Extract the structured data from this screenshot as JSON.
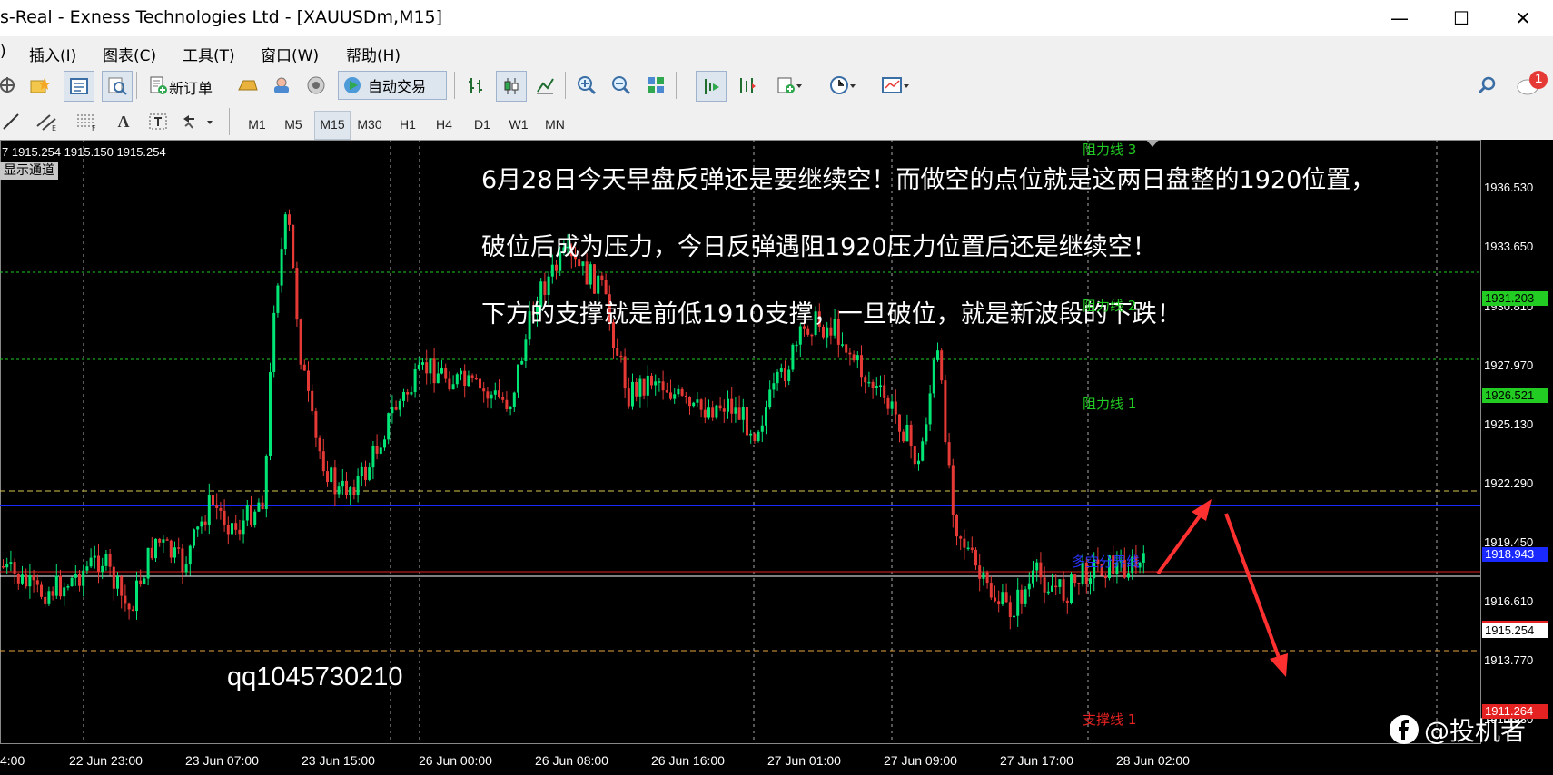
{
  "window": {
    "title": "s-Real - Exness Technologies Ltd - [XAUUSDm,M15]",
    "minimize": "—",
    "maximize": "☐",
    "close": "✕"
  },
  "menu": {
    "partial": ")",
    "items": [
      "插入(I)",
      "图表(C)",
      "工具(T)",
      "窗口(W)",
      "帮助(H)"
    ]
  },
  "mdi": {
    "minimize": "–",
    "restore": "▫",
    "close": "×"
  },
  "toolbar": {
    "new_order": "新订单",
    "auto_trading": "自动交易",
    "notification_count": "1"
  },
  "timeframes": [
    "M1",
    "M5",
    "M15",
    "M30",
    "H1",
    "H4",
    "D1",
    "W1",
    "MN"
  ],
  "active_timeframe": "M15",
  "chart": {
    "info": "7 1915.254 1915.150 1915.254",
    "channel_label": "显示通道",
    "annotations": [
      "6月28日今天早盘反弹还是要继续空！而做空的点位就是这两日盘整的1920位置，",
      "破位后成为压力，今日反弹遇阻1920压力位置后还是继续空！",
      "下方的支撑就是前低1910支撑，一旦破位，就是新波段的下跌！"
    ],
    "watermark_qq": "qq1045730210",
    "watermark_brand": "@投机者",
    "price_levels": [
      "1936.530",
      "1933.650",
      "1930.810",
      "1927.970",
      "1925.130",
      "1922.290",
      "1919.450",
      "1916.610",
      "1913.770",
      "1910.930"
    ],
    "marked_prices": {
      "resistance_2": "1931.203",
      "resistance_1": "1926.521",
      "divider": "1918.943",
      "current": "1915.254",
      "support": "1911.264"
    },
    "level_labels": {
      "resistance_3": "阻力线 3",
      "resistance_2": "阻力线 2",
      "resistance_1": "阻力线 1",
      "divider": "多空分界线",
      "support": "支撑线 1"
    },
    "time_labels": [
      "4:00",
      "22 Jun 23:00",
      "23 Jun 07:00",
      "23 Jun 15:00",
      "26 Jun 00:00",
      "26 Jun 08:00",
      "26 Jun 16:00",
      "27 Jun 01:00",
      "27 Jun 09:00",
      "27 Jun 17:00",
      "28 Jun 02:00"
    ],
    "colors": {
      "bull": "#00e676",
      "bear": "#e53935",
      "resistance": "#22cc22",
      "divider": "#1a2aff",
      "support": "#e52222",
      "arrow": "#ff3030"
    }
  }
}
